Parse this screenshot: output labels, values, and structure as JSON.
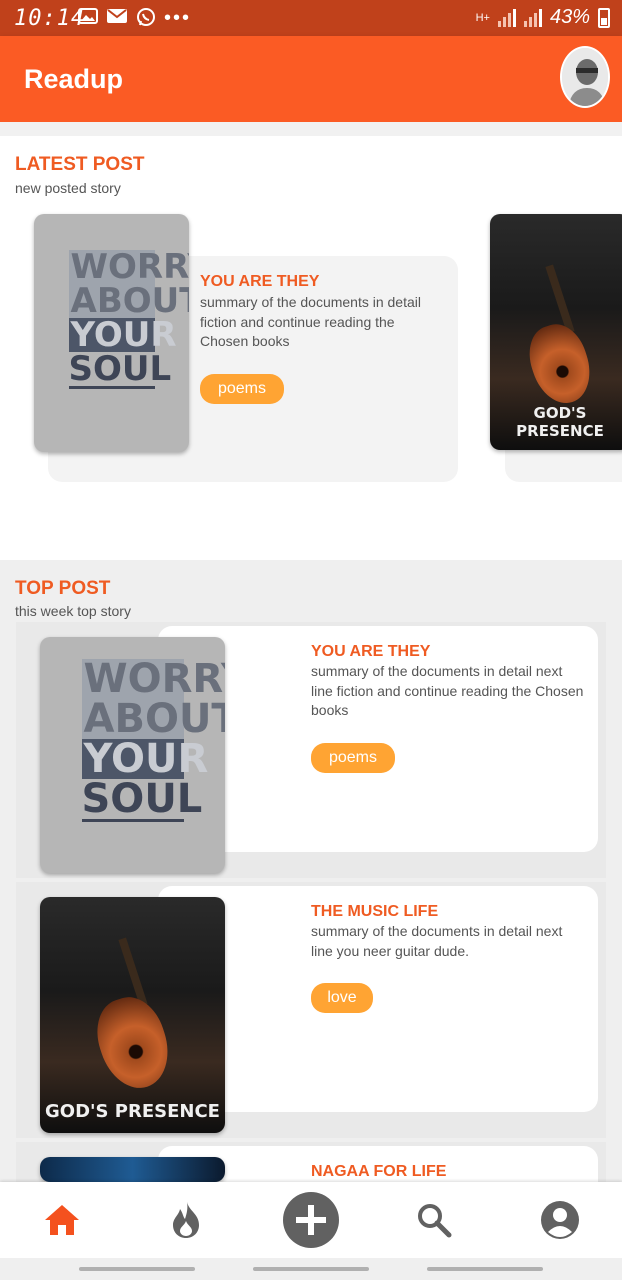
{
  "status_bar": {
    "time": "10:14",
    "battery": "43%",
    "network": "H+",
    "icons": [
      "image-icon",
      "mail-icon",
      "whatsapp-icon",
      "more-icon"
    ]
  },
  "app_bar": {
    "title": "Readup",
    "avatar": "profile-avatar"
  },
  "latest": {
    "title": "LATEST POST",
    "subtitle": "new posted story",
    "posts": [
      {
        "cover": {
          "line1": "WORRY",
          "line2": "ABOUT",
          "line3": "YOUR",
          "line4": "SOUL"
        },
        "title": "YOU ARE THEY",
        "summary": "summary of the documents in detail fiction and continue reading the Chosen books",
        "tag": "poems"
      },
      {
        "cover": {
          "caption": "GOD'S PRESENCE"
        }
      }
    ]
  },
  "top": {
    "title": "TOP POST",
    "subtitle": "this week top story",
    "posts": [
      {
        "cover": {
          "line1": "WORRY",
          "line2": "ABOUT",
          "line3": "YOUR",
          "line4": "SOUL"
        },
        "title": "YOU ARE THEY",
        "summary": "summary of the documents in detail next line fiction and continue reading the Chosen books",
        "tag": "poems"
      },
      {
        "cover": {
          "caption": "GOD'S PRESENCE"
        },
        "title": "THE MUSIC LIFE",
        "summary": "summary of the documents in detail next line you neer guitar dude.",
        "tag": "love"
      },
      {
        "title": "NAGAA FOR LIFE"
      }
    ]
  },
  "bottom_nav": [
    "home-icon",
    "trending-fire-icon",
    "add-icon",
    "search-icon",
    "account-icon"
  ],
  "colors": {
    "status_bar": "#c0411b",
    "app_bar": "#fb5b24",
    "accent_text": "#ef5b22",
    "chip": "#ffa433",
    "active_nav": "#f4511e",
    "inactive_nav": "#616161"
  }
}
